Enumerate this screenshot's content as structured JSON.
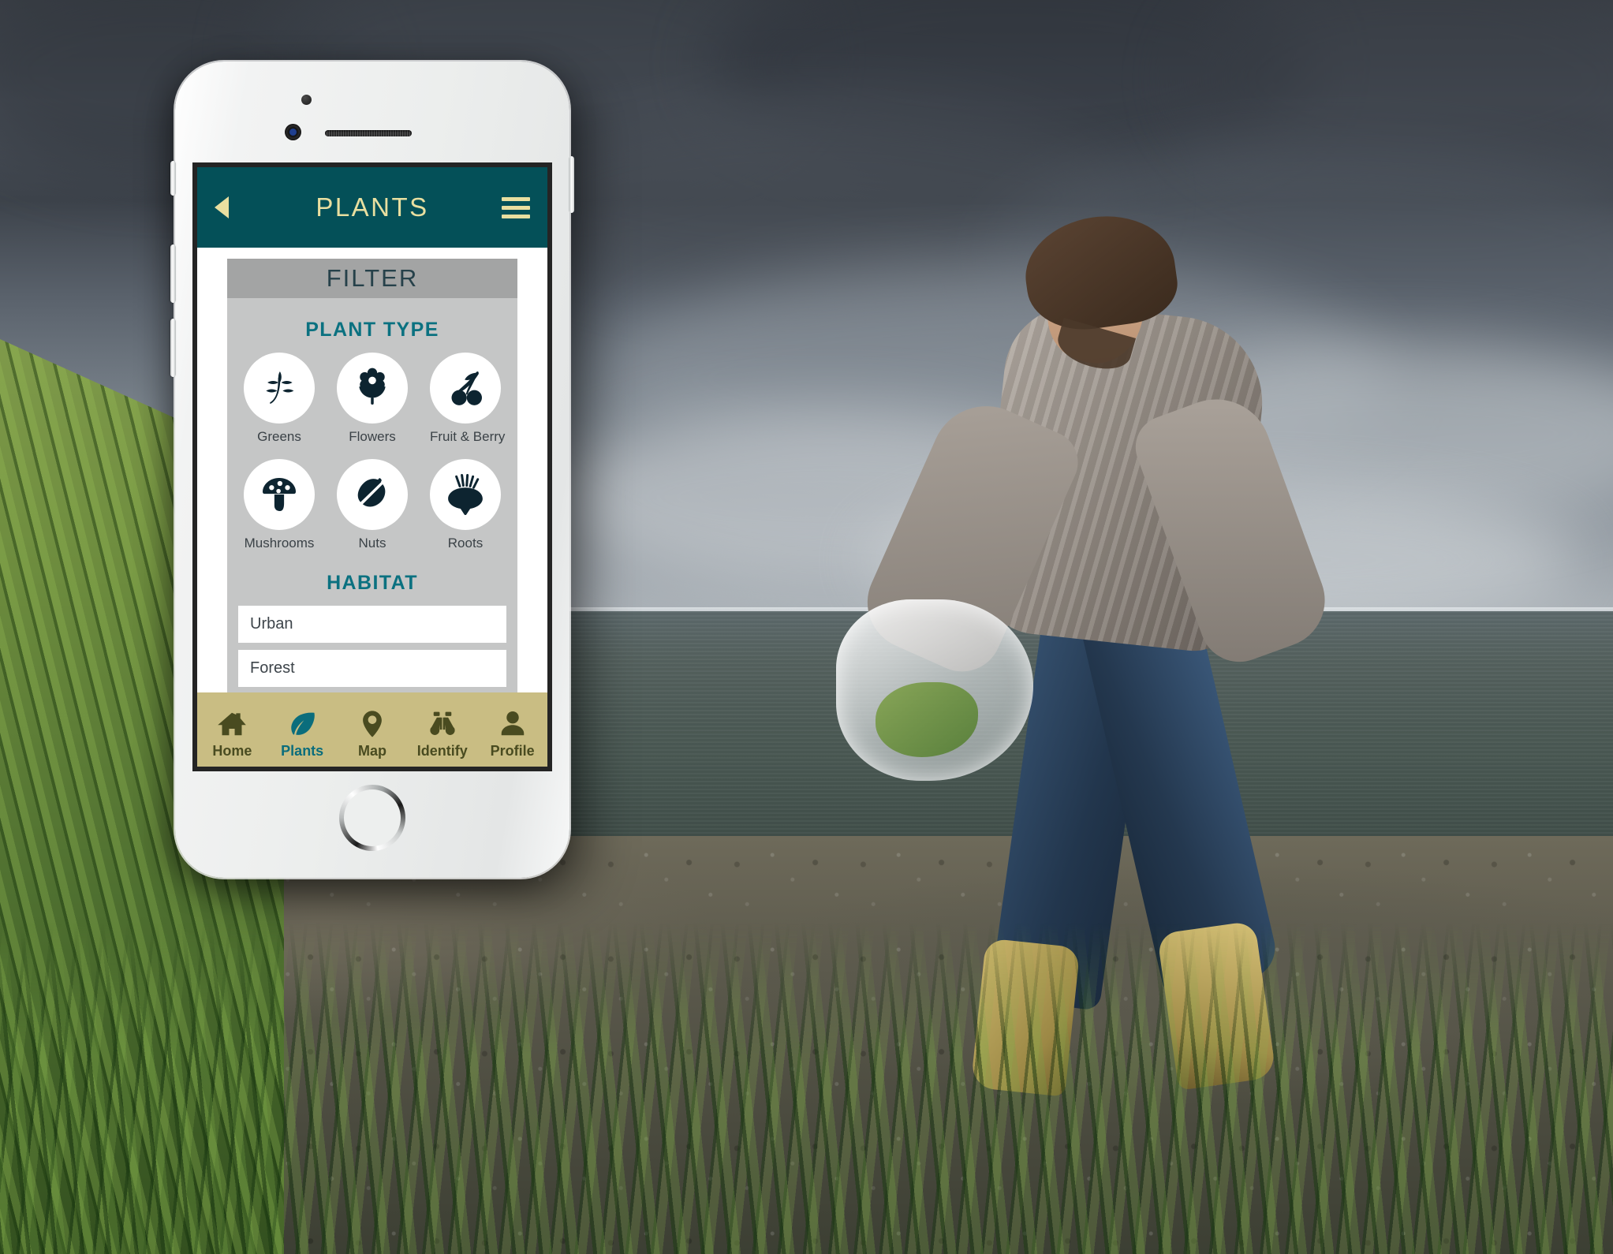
{
  "background": {
    "scene_description": "Man foraging greens into a plastic bag at a windswept stony shoreline under heavy storm clouds, tall grass at left"
  },
  "device": {
    "type": "smartphone-mockup",
    "frame_color": "#eceeed",
    "bezel_color": "#242424",
    "parts": {
      "sensor": "proximity-sensor",
      "camera": "front-camera",
      "speaker": "earpiece-speaker",
      "home_button": "home-button",
      "silent_switch": "silent-switch",
      "volume_up": "volume-up-button",
      "volume_down": "volume-down-button",
      "power": "power-button"
    }
  },
  "colors": {
    "header_teal": "#045058",
    "header_text_gold": "#e9dfa0",
    "accent_teal": "#0b7180",
    "panel_gray": "#c5c6c6",
    "filter_bar_gray": "#a3a4a4",
    "nav_tan": "#c9bd83",
    "nav_olive": "#494b20",
    "nav_active_teal": "#0b6d7c",
    "icon_dark": "#0d2430"
  },
  "app": {
    "header": {
      "title": "PLANTS",
      "back_icon": "back-arrow-icon",
      "menu_icon": "hamburger-menu-icon"
    },
    "filter": {
      "title": "FILTER",
      "plant_type": {
        "title": "PLANT TYPE",
        "options": [
          {
            "label": "Greens",
            "icon": "leaf-branch-icon"
          },
          {
            "label": "Flowers",
            "icon": "flower-icon"
          },
          {
            "label": "Fruit & Berry",
            "icon": "cherries-icon"
          },
          {
            "label": "Mushrooms",
            "icon": "mushroom-icon"
          },
          {
            "label": "Nuts",
            "icon": "acorn-icon"
          },
          {
            "label": "Roots",
            "icon": "beet-root-icon"
          }
        ]
      },
      "habitat": {
        "title": "HABITAT",
        "options": [
          {
            "label": "Urban"
          },
          {
            "label": "Forest"
          },
          {
            "label": ""
          }
        ]
      }
    },
    "bottom_nav": {
      "active": "Plants",
      "items": [
        {
          "label": "Home",
          "icon": "home-icon"
        },
        {
          "label": "Plants",
          "icon": "leaf-icon"
        },
        {
          "label": "Map",
          "icon": "map-pin-icon"
        },
        {
          "label": "Identify",
          "icon": "binoculars-icon"
        },
        {
          "label": "Profile",
          "icon": "person-icon"
        }
      ]
    }
  }
}
